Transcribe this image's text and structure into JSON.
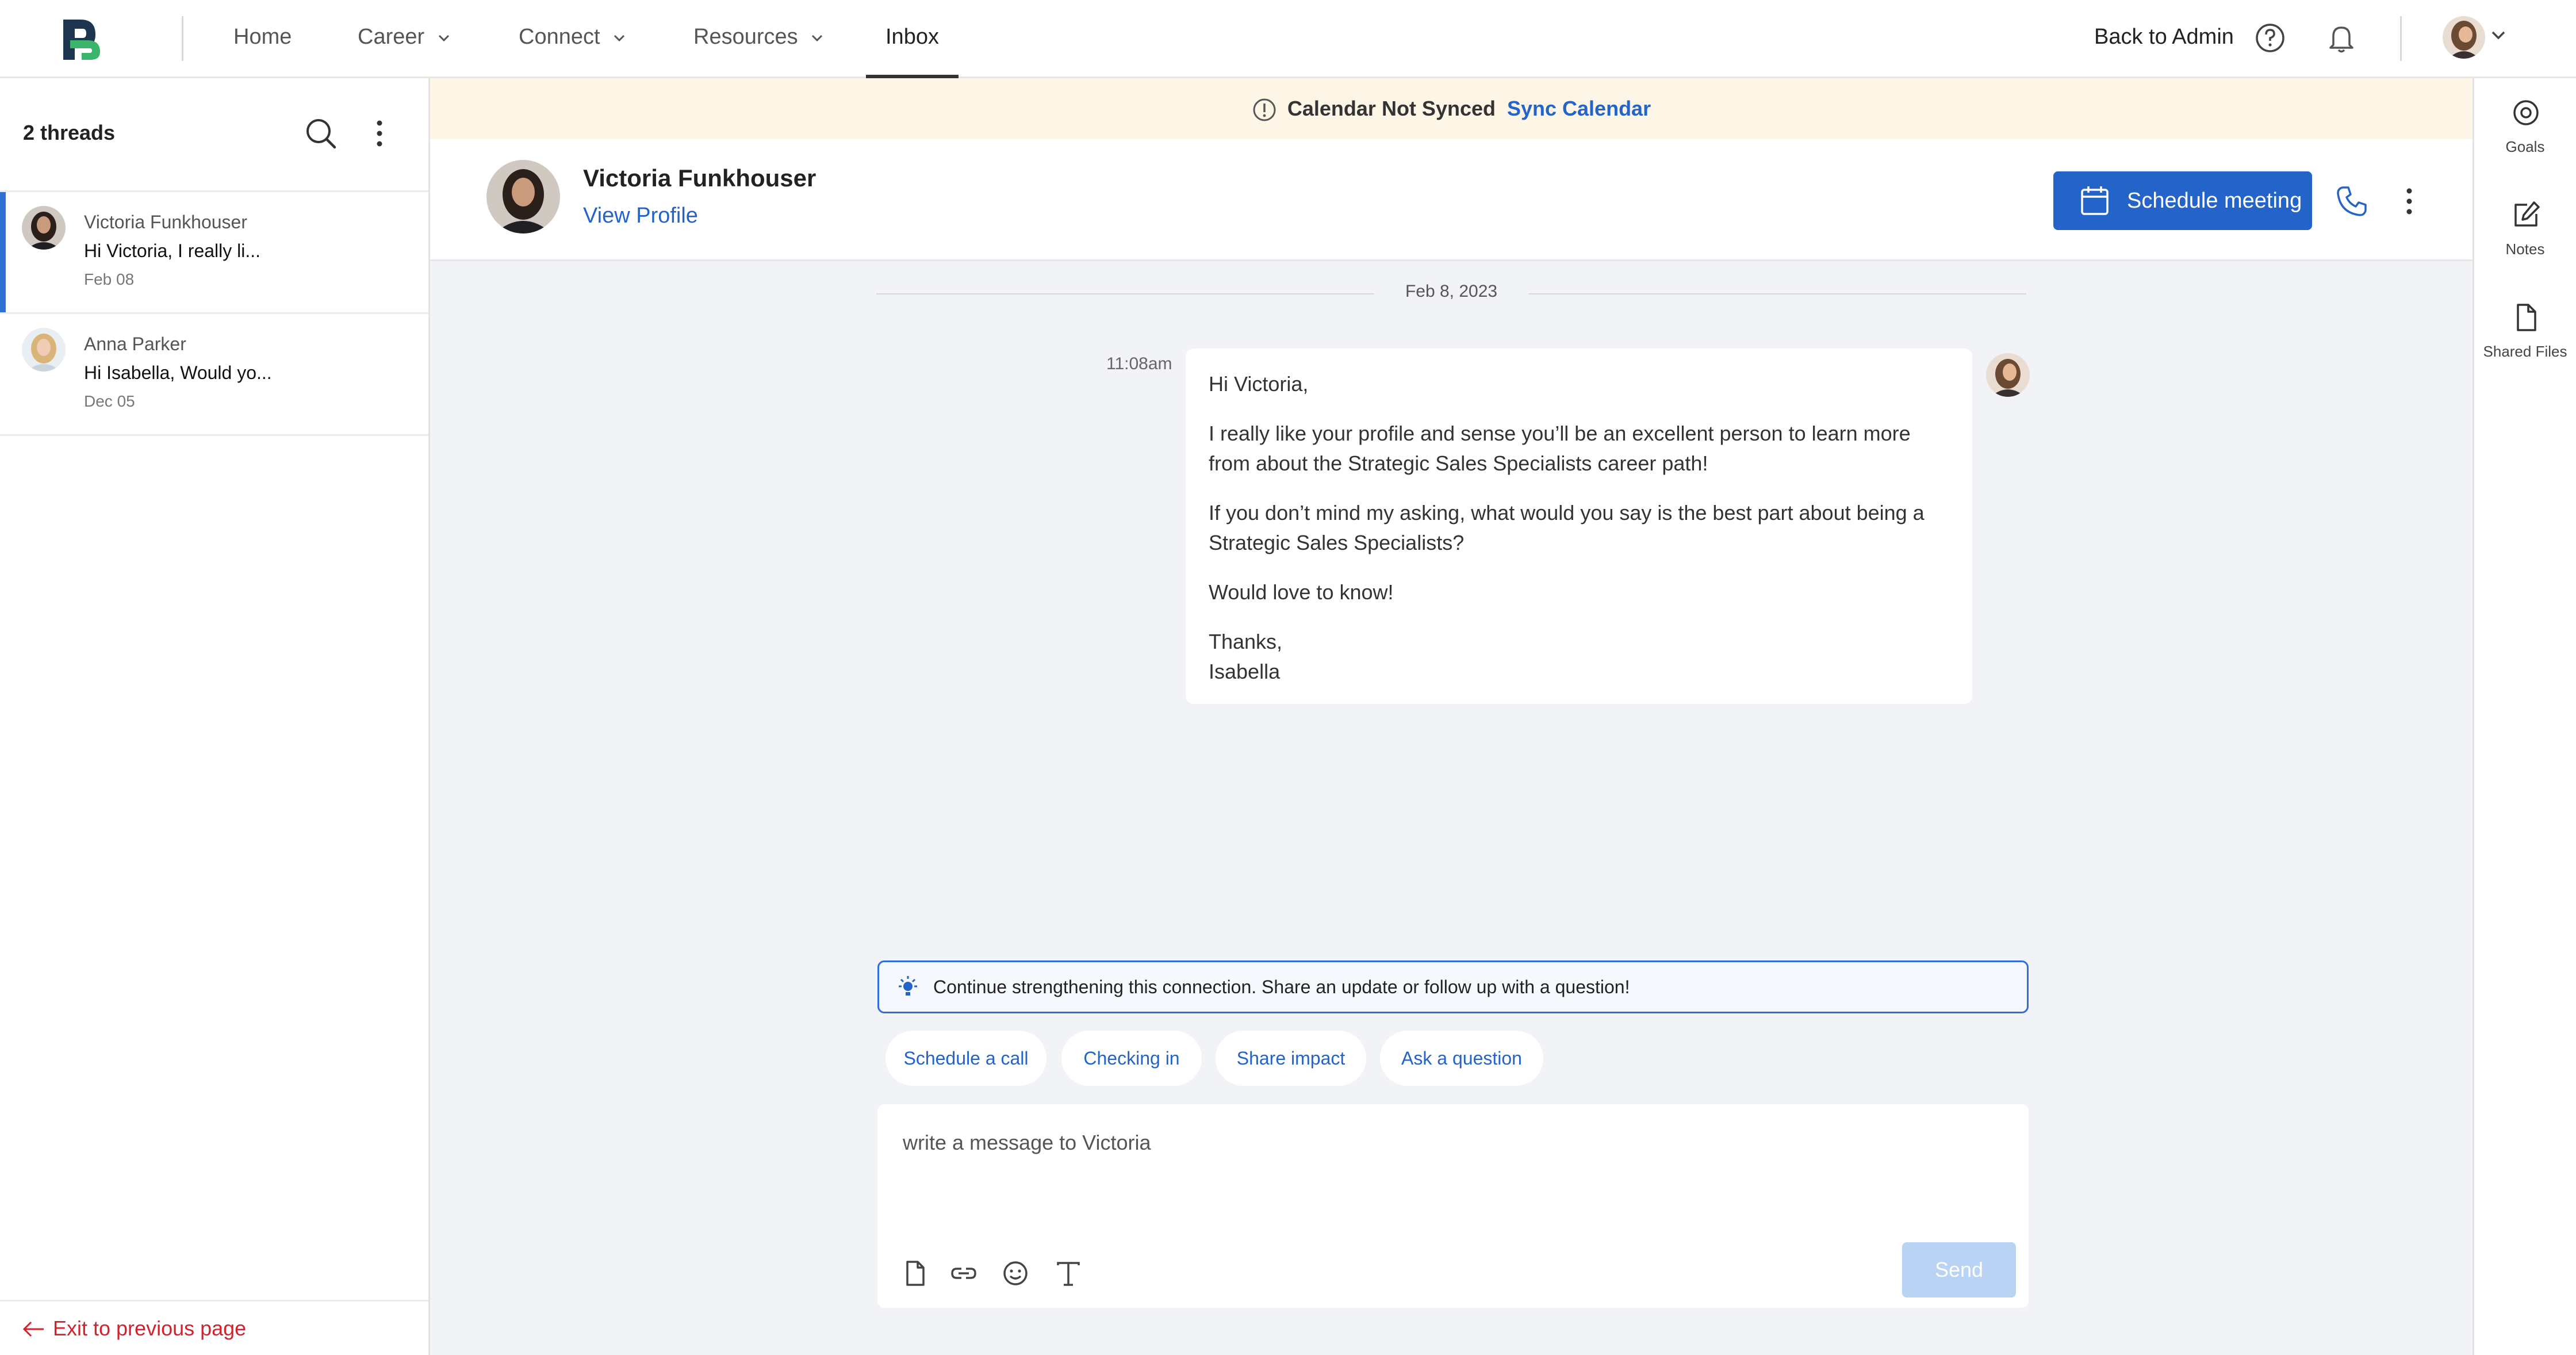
{
  "nav": {
    "items": [
      {
        "label": "Home",
        "has_dropdown": false
      },
      {
        "label": "Career",
        "has_dropdown": true
      },
      {
        "label": "Connect",
        "has_dropdown": true
      },
      {
        "label": "Resources",
        "has_dropdown": true
      },
      {
        "label": "Inbox",
        "has_dropdown": false,
        "active": true
      }
    ],
    "back_to_admin": "Back to Admin",
    "icons": [
      "help-icon",
      "bell-icon",
      "avatar",
      "chevron-down-icon"
    ]
  },
  "sidebar": {
    "threads_count": "2 threads",
    "threads": [
      {
        "name": "Victoria Funkhouser",
        "snippet": "Hi Victoria,  I really li...",
        "date": "Feb 08",
        "active": true
      },
      {
        "name": "Anna Parker",
        "snippet": "Hi Isabella, Would yo...",
        "date": "Dec 05",
        "active": false
      }
    ],
    "exit_label": "Exit to previous page"
  },
  "banner": {
    "status": "Calendar Not Synced",
    "action": "Sync Calendar",
    "accent": "#fdf6e7"
  },
  "conversation": {
    "contact_name": "Victoria Funkhouser",
    "view_profile": "View Profile",
    "schedule_label": "Schedule meeting",
    "date_separator": "Feb 8, 2023",
    "message": {
      "time": "11:08am",
      "paragraphs": [
        "Hi Victoria,",
        "I really like your profile and sense you’ll be an excellent person to learn more from about the Strategic Sales Specialists career path!",
        "If you don’t mind my asking, what would you say is the best part about being a Strategic Sales Specialists?",
        "Would love to know!",
        "Thanks,",
        "Isabella"
      ]
    },
    "tip": "Continue strengthening this connection. Share an update or follow up with a question!",
    "chips": [
      "Schedule a call",
      "Checking in",
      "Share impact",
      "Ask a question"
    ],
    "composer_placeholder": "write a message to Victoria",
    "send_label": "Send",
    "toolbar_icons": [
      "attach-file-icon",
      "link-icon",
      "emoji-icon",
      "text-format-icon"
    ]
  },
  "right_rail": {
    "items": [
      {
        "label": "Goals",
        "icon": "target-icon"
      },
      {
        "label": "Notes",
        "icon": "edit-note-icon"
      },
      {
        "label": "Shared Files",
        "icon": "file-icon"
      }
    ]
  },
  "colors": {
    "primary": "#2463c7",
    "send_disabled": "#b9d3f4",
    "exit_link": "#d2222d",
    "background": "#f2f3f6"
  }
}
